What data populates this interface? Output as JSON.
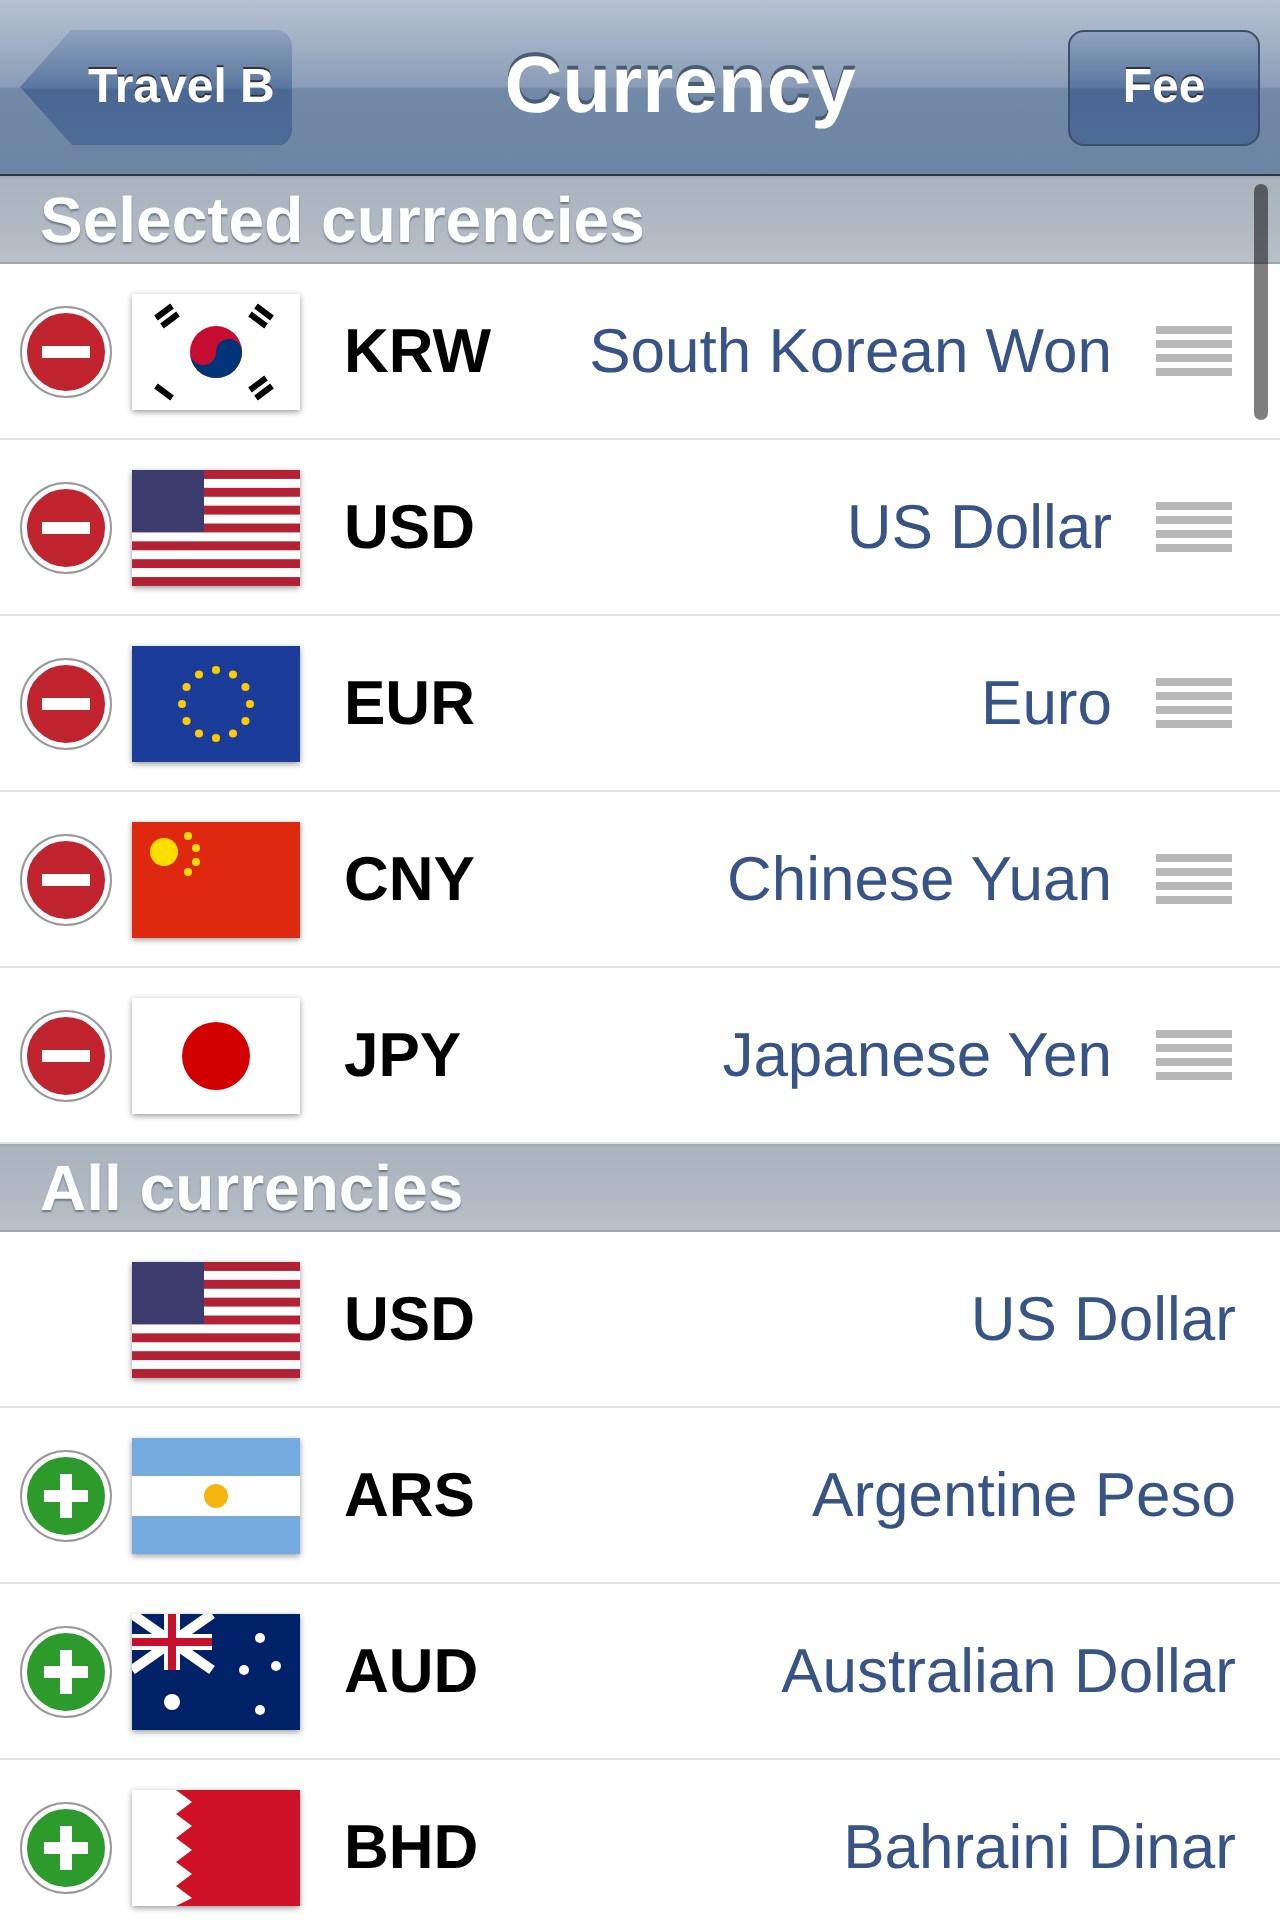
{
  "nav": {
    "back": "Travel B",
    "title": "Currency",
    "action": "Fee"
  },
  "sections": [
    {
      "title": "Selected currencies",
      "rows": [
        {
          "kind": "remove",
          "code": "KRW",
          "name": "South Korean Won"
        },
        {
          "kind": "remove",
          "code": "USD",
          "name": "US Dollar"
        },
        {
          "kind": "remove",
          "code": "EUR",
          "name": "Euro"
        },
        {
          "kind": "remove",
          "code": "CNY",
          "name": "Chinese Yuan"
        },
        {
          "kind": "remove",
          "code": "JPY",
          "name": "Japanese Yen"
        }
      ]
    },
    {
      "title": "All currencies",
      "rows": [
        {
          "kind": "added",
          "code": "USD",
          "name": "US Dollar"
        },
        {
          "kind": "add",
          "code": "ARS",
          "name": "Argentine Peso"
        },
        {
          "kind": "add",
          "code": "AUD",
          "name": "Australian Dollar"
        },
        {
          "kind": "add",
          "code": "BHD",
          "name": "Bahraini Dinar"
        }
      ]
    }
  ]
}
